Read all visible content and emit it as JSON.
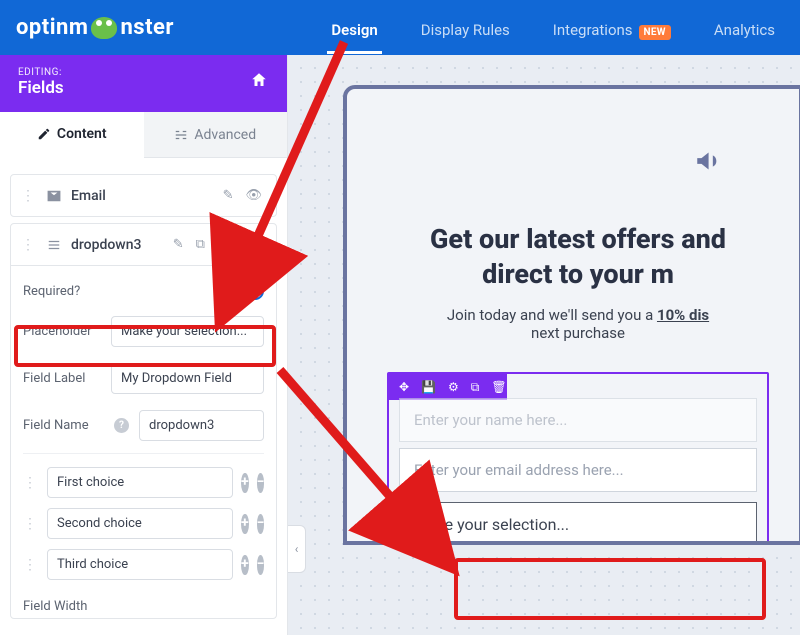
{
  "nav": {
    "logo_left": "optinm",
    "logo_right": "nster",
    "items": [
      {
        "label": "Design",
        "active": true
      },
      {
        "label": "Display Rules"
      },
      {
        "label": "Integrations",
        "badge": "NEW"
      },
      {
        "label": "Analytics"
      }
    ]
  },
  "panel": {
    "editing_label": "EDITING:",
    "editing_title": "Fields",
    "tabs": [
      {
        "label": "Content",
        "active": true
      },
      {
        "label": "Advanced"
      }
    ],
    "email_field": {
      "label": "Email"
    },
    "dropdown_field": {
      "label": "dropdown3",
      "required_label": "Required?",
      "required_on": true,
      "placeholder_label": "Placeholder",
      "placeholder_value": "Make your selection...",
      "fieldlabel_label": "Field Label",
      "fieldlabel_value": "My Dropdown Field",
      "fieldname_label": "Field Name",
      "fieldname_value": "dropdown3",
      "choices": [
        "First choice",
        "Second choice",
        "Third choice"
      ],
      "fieldwidth_label": "Field Width"
    }
  },
  "preview": {
    "headline_l1": "Get our latest offers and",
    "headline_l2": "direct to your m",
    "sub_prefix": "Join today and we'll send you a ",
    "sub_bold": "10% dis",
    "sub_l2": "next purchase",
    "name_placeholder": "Enter your name here...",
    "email_placeholder": "Enter your email address here...",
    "select_text": "Make your selection..."
  }
}
